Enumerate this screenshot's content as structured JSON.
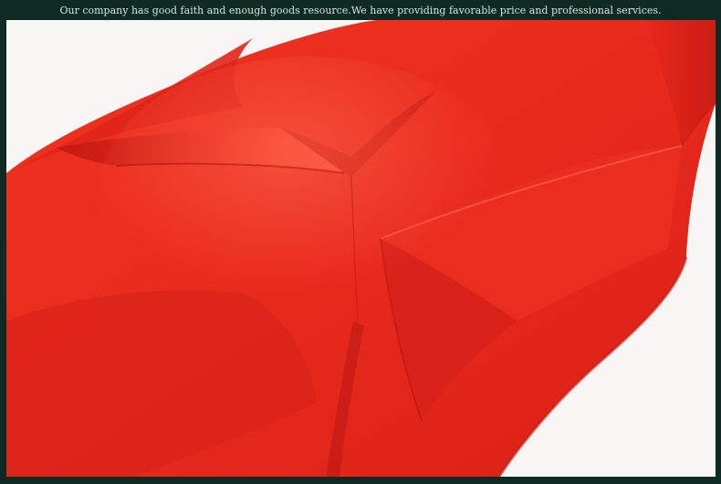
{
  "banner": {
    "text": "Our company has good faith and enough goods resource.We have providing favorable price and professional services."
  },
  "photo": {
    "subject": "red-dress-fabric-closeup-icon"
  },
  "colors": {
    "frame": "#0f2a22",
    "banner_text": "#d8e4dc",
    "background": "#f6f4f2",
    "fabric_base": "#e8261c",
    "fabric_shadow": "#b81510",
    "fabric_highlight": "#ff5a45"
  }
}
